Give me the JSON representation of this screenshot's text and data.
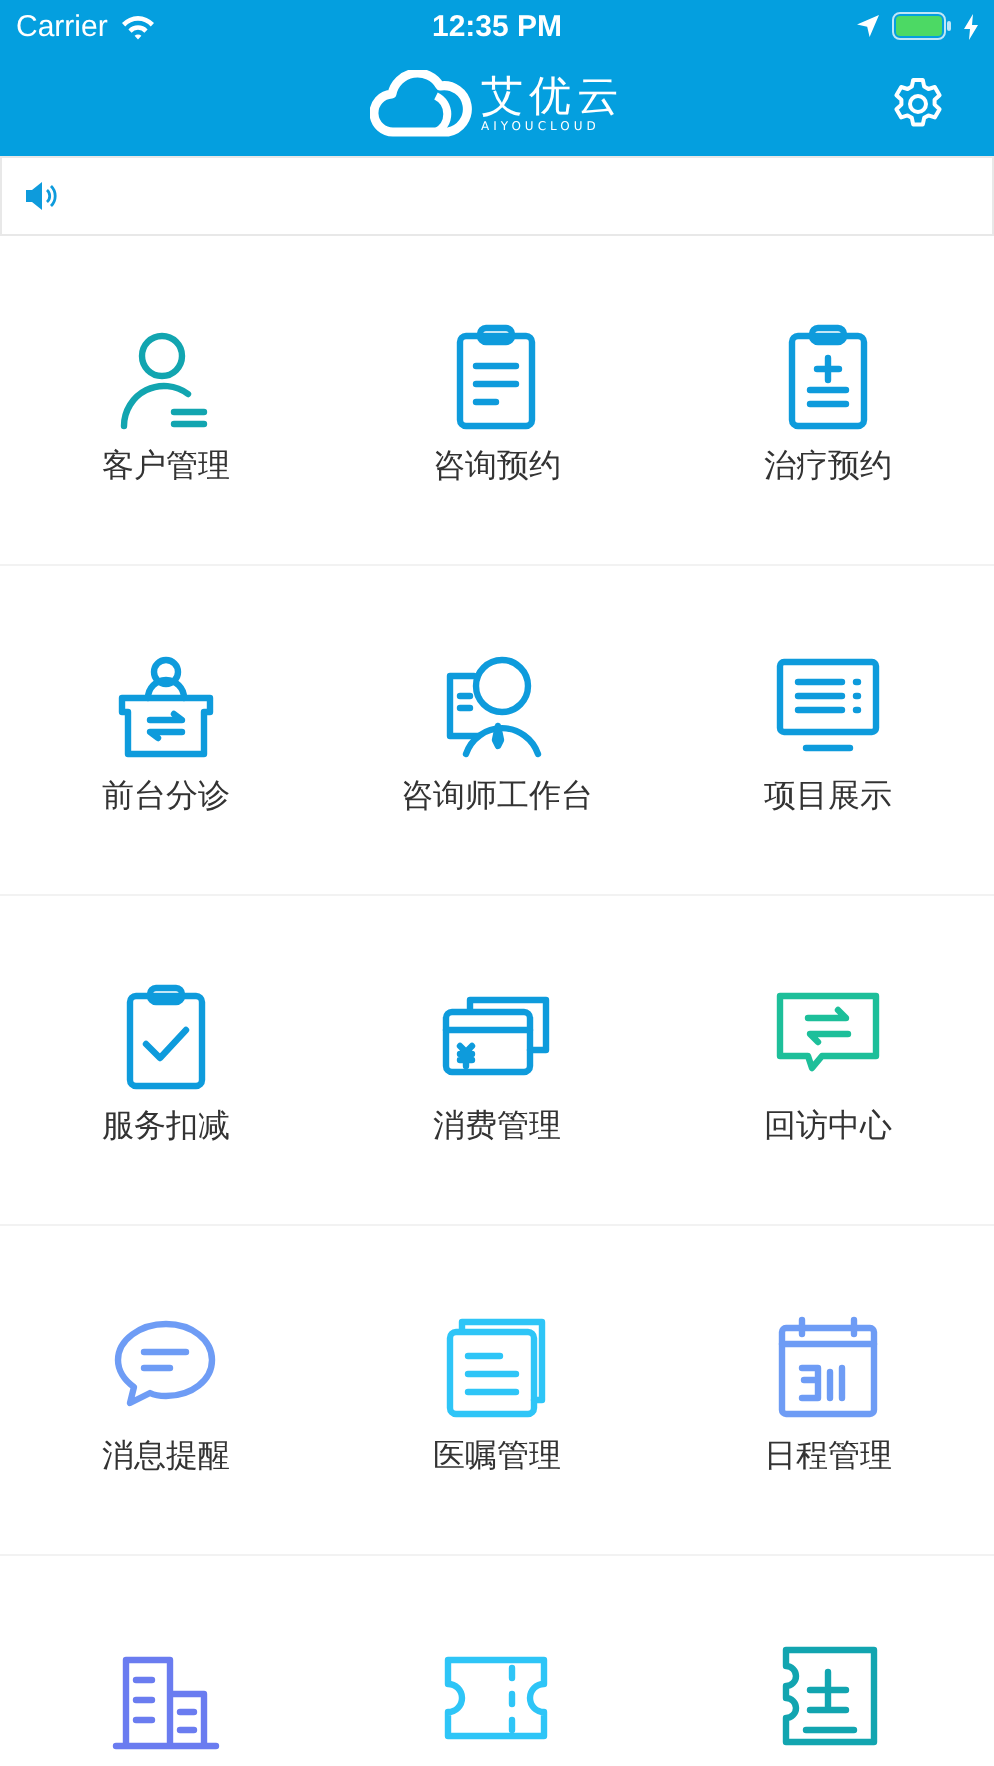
{
  "status_bar": {
    "carrier": "Carrier",
    "time": "12:35 PM"
  },
  "nav_bar": {
    "logo_text": "艾优云",
    "logo_subtext": "AIYOUCLOUD"
  },
  "menu": [
    {
      "kind": "person",
      "label": "客户管理",
      "color": "#12a5b0"
    },
    {
      "kind": "clipboard",
      "label": "咨询预约",
      "color": "#0e9bdc"
    },
    {
      "kind": "clipboard-plus",
      "label": "治疗预约",
      "color": "#0e9bdc"
    },
    {
      "kind": "desk",
      "label": "前台分诊",
      "color": "#0e9bdc"
    },
    {
      "kind": "consultant",
      "label": "咨询师工作台",
      "color": "#0e9bdc"
    },
    {
      "kind": "monitor",
      "label": "项目展示",
      "color": "#0e9bdc"
    },
    {
      "kind": "clipboard-check",
      "label": "服务扣减",
      "color": "#0e9bdc"
    },
    {
      "kind": "cards",
      "label": "消费管理",
      "color": "#0e9bdc"
    },
    {
      "kind": "chat-exchange",
      "label": "回访中心",
      "color": "#1dbf9a"
    },
    {
      "kind": "chat",
      "label": "消息提醒",
      "color": "#6e9cf5"
    },
    {
      "kind": "documents",
      "label": "医嘱管理",
      "color": "#2ec5f7"
    },
    {
      "kind": "calendar",
      "label": "日程管理",
      "color": "#6e9cf5"
    },
    {
      "kind": "building",
      "color": "#6a7cf0"
    },
    {
      "kind": "ticket",
      "color": "#2ec5f7"
    },
    {
      "kind": "note-plus",
      "color": "#12a5b0"
    }
  ]
}
